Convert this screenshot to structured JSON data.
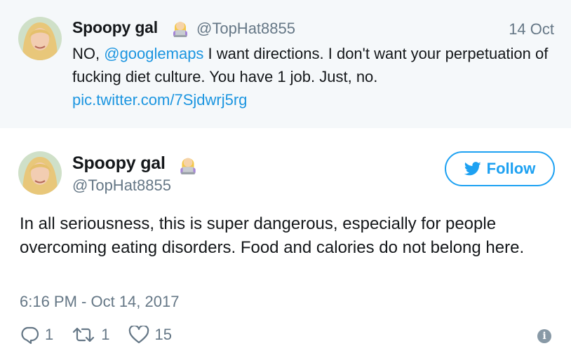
{
  "parent_tweet": {
    "name": "Spoopy gal",
    "handle": "@TopHat8855",
    "date": "14 Oct",
    "text_prefix": "NO, ",
    "mention": "@googlemaps",
    "text_body": " I want directions. I don't want your perpetuation of fucking diet culture. You have 1 job. Just, no.",
    "link": "pic.twitter.com/7Sjdwrj5rg"
  },
  "main_tweet": {
    "name": "Spoopy gal",
    "handle": "@TopHat8855",
    "follow_label": "Follow",
    "text": "In all seriousness, this is super dangerous, especially for people overcoming eating disorders. Food and calories do not belong here.",
    "timestamp": "6:16 PM - Oct 14, 2017",
    "replies": "1",
    "retweets": "1",
    "likes": "15"
  },
  "icons": {
    "follow": "twitter-bird-icon",
    "reply": "reply-icon",
    "retweet": "retweet-icon",
    "like": "heart-icon",
    "info": "info-icon",
    "emoji": "woman-technologist-emoji"
  },
  "colors": {
    "accent": "#1da1f2",
    "link": "#1b95e0",
    "muted": "#657786",
    "parent_bg": "#f5f8fa"
  }
}
